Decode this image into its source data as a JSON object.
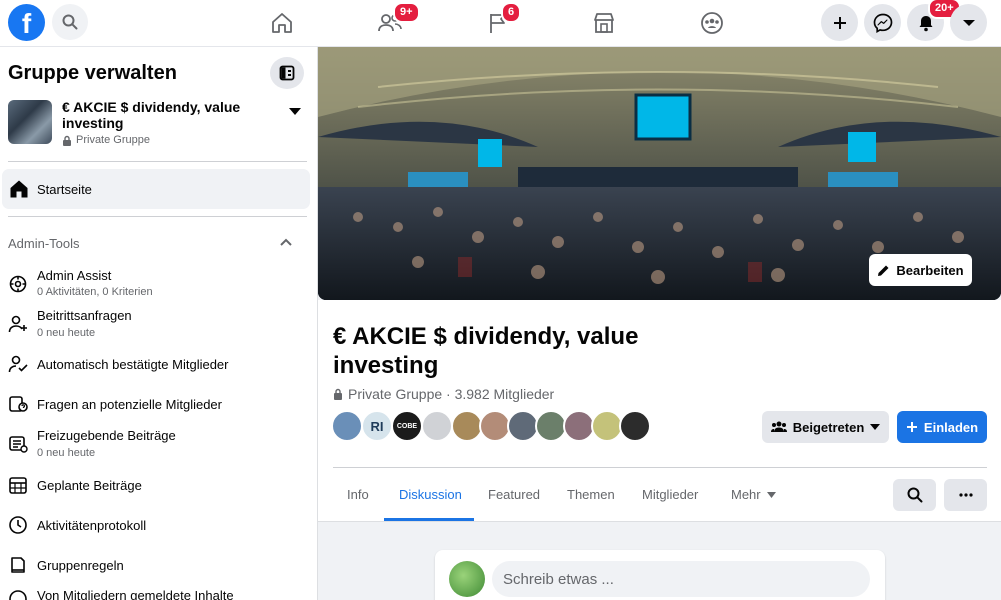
{
  "topbar": {
    "logo_letter": "f",
    "badges": {
      "friends": "9+",
      "flag": "6",
      "notifications": "20+"
    }
  },
  "sidebar": {
    "title": "Gruppe verwalten",
    "group_name": "€ AKCIE $ dividendy, value investing",
    "group_privacy": "Private Gruppe",
    "home_label": "Startseite",
    "admin_tools_label": "Admin-Tools",
    "tools": [
      {
        "title": "Admin Assist",
        "sub": "0 Aktivitäten, 0 Kriterien",
        "icon": "admin-assist-icon"
      },
      {
        "title": "Beitrittsanfragen",
        "sub": "0 neu heute",
        "icon": "member-request-icon"
      },
      {
        "title": "Automatisch bestätigte Mitglieder",
        "sub": "",
        "icon": "auto-approve-icon"
      },
      {
        "title": "Fragen an potenzielle Mitglieder",
        "sub": "",
        "icon": "questions-icon"
      },
      {
        "title": "Freizugebende Beiträge",
        "sub": "0 neu heute",
        "icon": "pending-posts-icon"
      },
      {
        "title": "Geplante Beiträge",
        "sub": "",
        "icon": "calendar-icon"
      },
      {
        "title": "Aktivitätenprotokoll",
        "sub": "",
        "icon": "clock-icon"
      },
      {
        "title": "Gruppenregeln",
        "sub": "",
        "icon": "rules-icon"
      },
      {
        "title": "Von Mitgliedern gemeldete Inhalte",
        "sub": "",
        "icon": "report-icon"
      }
    ]
  },
  "main": {
    "edit_label": "Bearbeiten",
    "title": "€ AKCIE $ dividendy, value investing",
    "privacy": "Private Gruppe · 3.982 Mitglieder",
    "avatar_initials": "RI",
    "avatar_text_3": "COBE",
    "joined_label": "Beigetreten",
    "invite_label": "Einladen",
    "tabs": [
      {
        "label": "Info"
      },
      {
        "label": "Diskussion"
      },
      {
        "label": "Featured"
      },
      {
        "label": "Themen"
      },
      {
        "label": "Mitglieder"
      },
      {
        "label": "Mehr"
      }
    ],
    "composer_placeholder": "Schreib etwas ..."
  },
  "colors": {
    "accent": "#1b74e4",
    "badge": "#e41e3f",
    "cover_screen": "#00b7e8"
  }
}
